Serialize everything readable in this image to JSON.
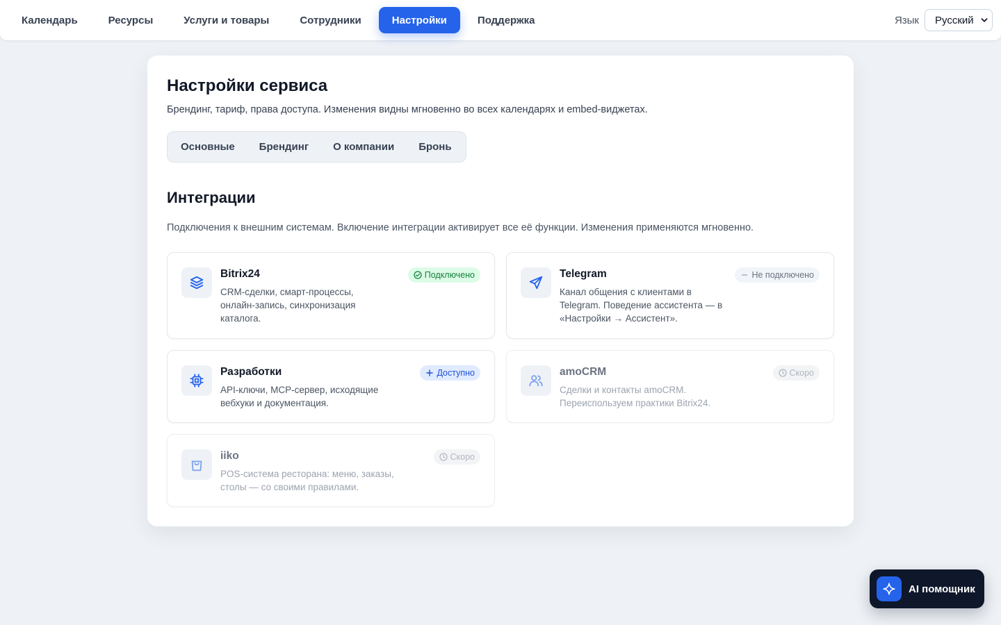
{
  "nav": {
    "items": [
      {
        "label": "Календарь",
        "active": false
      },
      {
        "label": "Ресурсы",
        "active": false
      },
      {
        "label": "Услуги и товары",
        "active": false
      },
      {
        "label": "Сотрудники",
        "active": false
      },
      {
        "label": "Настройки",
        "active": true
      },
      {
        "label": "Поддержка",
        "active": false
      }
    ],
    "language_label": "Язык",
    "language_value": "Русский"
  },
  "page": {
    "title": "Настройки сервиса",
    "subtitle": "Брендинг, тариф, права доступа. Изменения видны мгновенно во всех календарях и embed-виджетах.",
    "tabs": [
      "Основные",
      "Брендинг",
      "О компании",
      "Бронь"
    ]
  },
  "integrations": {
    "title": "Интеграции",
    "subtitle": "Подключения к внешним системам. Включение интеграции активирует все её функции. Изменения применяются мгновенно.",
    "items": [
      {
        "name": "Bitrix24",
        "description": "CRM-сделки, смарт-процессы, онлайн-запись, синхронизация каталога.",
        "status": "Подключено",
        "status_type": "connected",
        "icon": "layers-icon"
      },
      {
        "name": "Telegram",
        "description": "Канал общения с клиентами в Telegram. Поведение ассистента — в «Настройки → Ассистент».",
        "status": "Не подключено",
        "status_type": "not-connected",
        "icon": "send-icon"
      },
      {
        "name": "Разработки",
        "description": "API-ключи, MCP-сервер, исходящие вебхуки и документация.",
        "status": "Доступно",
        "status_type": "available",
        "icon": "chip-icon"
      },
      {
        "name": "amoCRM",
        "description": "Сделки и контакты amoCRM. Переиспользуем практики Bitrix24.",
        "status": "Скоро",
        "status_type": "soon",
        "icon": "users-icon"
      },
      {
        "name": "iiko",
        "description": "POS-система ресторана: меню, заказы, столы — со своими правилами.",
        "status": "Скоро",
        "status_type": "soon",
        "icon": "shopping-bag-icon"
      }
    ]
  },
  "assistant": {
    "label": "AI помощник",
    "icon": "sparkle-icon"
  },
  "colors": {
    "accent": "#2563eb",
    "connected": "#15803d",
    "available": "#1d4ed8"
  }
}
